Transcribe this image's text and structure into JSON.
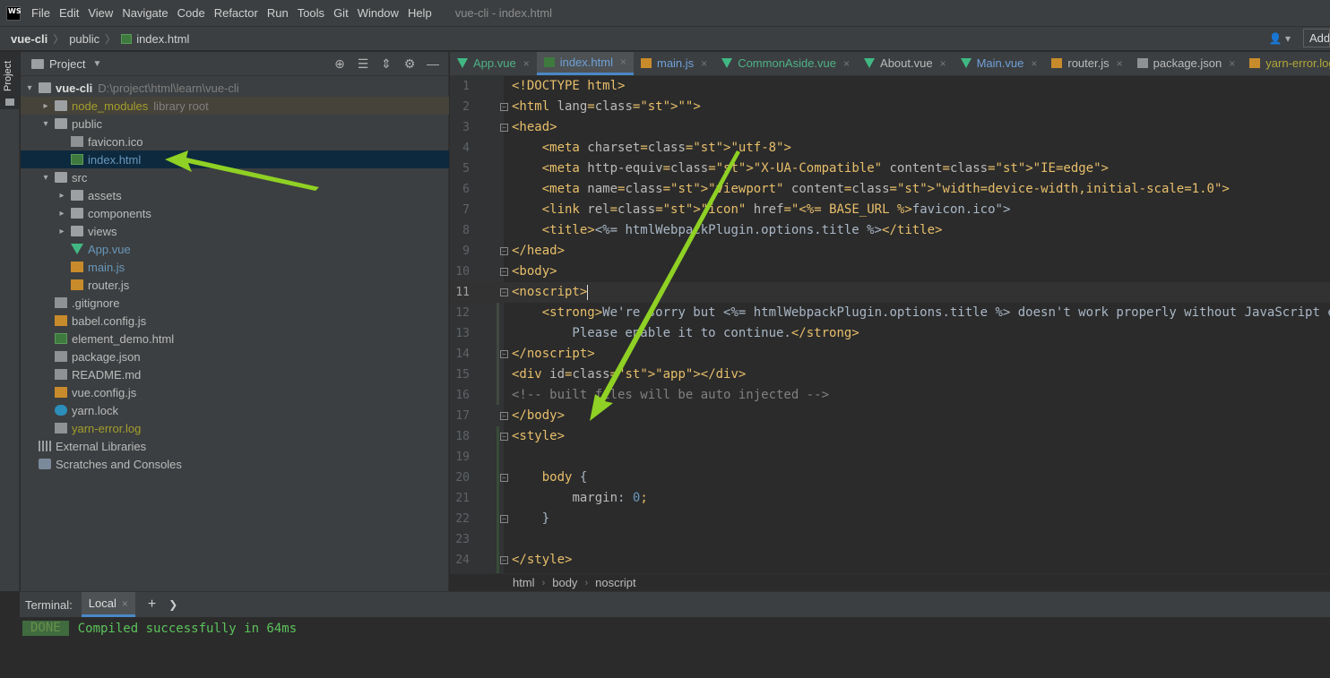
{
  "menubar": {
    "logo": "WS",
    "items": [
      "File",
      "Edit",
      "View",
      "Navigate",
      "Code",
      "Refactor",
      "Run",
      "Tools",
      "Git",
      "Window",
      "Help"
    ],
    "window_title": "vue-cli - index.html"
  },
  "navbar": {
    "crumbs": [
      "vue-cli",
      "public",
      "index.html"
    ],
    "add_label": "Add"
  },
  "toolstrip": {
    "project_tab": "Project"
  },
  "project": {
    "title": "Project",
    "tree": [
      {
        "label": "vue-cli",
        "hint": "D:\\project\\html\\learn\\vue-cli",
        "depth": 0,
        "arrow": "down",
        "icon": "folder"
      },
      {
        "label": "node_modules",
        "hint": "library root",
        "depth": 1,
        "arrow": "right",
        "icon": "folder"
      },
      {
        "label": "public",
        "hint": "",
        "depth": 1,
        "arrow": "down",
        "icon": "folder"
      },
      {
        "label": "favicon.ico",
        "hint": "",
        "depth": 2,
        "arrow": "",
        "icon": "file"
      },
      {
        "label": "index.html",
        "hint": "",
        "depth": 2,
        "arrow": "",
        "icon": "html"
      },
      {
        "label": "src",
        "hint": "",
        "depth": 1,
        "arrow": "down",
        "icon": "folder"
      },
      {
        "label": "assets",
        "hint": "",
        "depth": 2,
        "arrow": "right",
        "icon": "folder"
      },
      {
        "label": "components",
        "hint": "",
        "depth": 2,
        "arrow": "right",
        "icon": "folder"
      },
      {
        "label": "views",
        "hint": "",
        "depth": 2,
        "arrow": "right",
        "icon": "folder"
      },
      {
        "label": "App.vue",
        "hint": "",
        "depth": 2,
        "arrow": "",
        "icon": "vue"
      },
      {
        "label": "main.js",
        "hint": "",
        "depth": 2,
        "arrow": "",
        "icon": "js"
      },
      {
        "label": "router.js",
        "hint": "",
        "depth": 2,
        "arrow": "",
        "icon": "js"
      },
      {
        "label": ".gitignore",
        "hint": "",
        "depth": 1,
        "arrow": "",
        "icon": "file"
      },
      {
        "label": "babel.config.js",
        "hint": "",
        "depth": 1,
        "arrow": "",
        "icon": "js"
      },
      {
        "label": "element_demo.html",
        "hint": "",
        "depth": 1,
        "arrow": "",
        "icon": "html"
      },
      {
        "label": "package.json",
        "hint": "",
        "depth": 1,
        "arrow": "",
        "icon": "file"
      },
      {
        "label": "README.md",
        "hint": "",
        "depth": 1,
        "arrow": "",
        "icon": "file"
      },
      {
        "label": "vue.config.js",
        "hint": "",
        "depth": 1,
        "arrow": "",
        "icon": "js"
      },
      {
        "label": "yarn.lock",
        "hint": "",
        "depth": 1,
        "arrow": "",
        "icon": "yarn"
      },
      {
        "label": "yarn-error.log",
        "hint": "",
        "depth": 1,
        "arrow": "",
        "icon": "file"
      },
      {
        "label": "External Libraries",
        "hint": "",
        "depth": 0,
        "arrow": "",
        "icon": "lib"
      },
      {
        "label": "Scratches and Consoles",
        "hint": "",
        "depth": 0,
        "arrow": "",
        "icon": "scratch"
      }
    ]
  },
  "editor": {
    "tabs": [
      {
        "label": "App.vue",
        "icon": "vue",
        "style": "vue-name"
      },
      {
        "label": "index.html",
        "icon": "html",
        "style": "blue-name",
        "active": true
      },
      {
        "label": "main.js",
        "icon": "js",
        "style": "blue-name"
      },
      {
        "label": "CommonAside.vue",
        "icon": "vue",
        "style": "vue-name"
      },
      {
        "label": "About.vue",
        "icon": "vue",
        "style": ""
      },
      {
        "label": "Main.vue",
        "icon": "vue",
        "style": "blue-name"
      },
      {
        "label": "router.js",
        "icon": "js",
        "style": ""
      },
      {
        "label": "package.json",
        "icon": "json",
        "style": ""
      },
      {
        "label": "yarn-error.log",
        "icon": "js",
        "style": "yellow-name"
      }
    ],
    "lines": [
      "<!DOCTYPE html>",
      "<html lang=\"\">",
      "<head>",
      "    <meta charset=\"utf-8\">",
      "    <meta http-equiv=\"X-UA-Compatible\" content=\"IE=edge\">",
      "    <meta name=\"viewport\" content=\"width=device-width,initial-scale=1.0\">",
      "    <link rel=\"icon\" href=\"<%= BASE_URL %>favicon.ico\">",
      "    <title><%= htmlWebpackPlugin.options.title %></title>",
      "</head>",
      "<body>",
      "<noscript>",
      "    <strong>We're sorry but <%= htmlWebpackPlugin.options.title %> doesn't work properly without JavaScript enabled.",
      "        Please enable it to continue.</strong>",
      "</noscript>",
      "<div id=\"app\"></div>",
      "<!-- built files will be auto injected -->",
      "</body>",
      "<style>",
      "",
      "    body {",
      "        margin: 0;",
      "    }",
      "",
      "</style>"
    ],
    "current_line": 11,
    "breadcrumb": [
      "html",
      "body",
      "noscript"
    ]
  },
  "terminal": {
    "title": "Terminal:",
    "tab": "Local",
    "badge": "DONE",
    "message": "Compiled successfully in 64ms"
  },
  "colors": {
    "arrow": "#8fd124",
    "accent": "#4a88c7"
  }
}
